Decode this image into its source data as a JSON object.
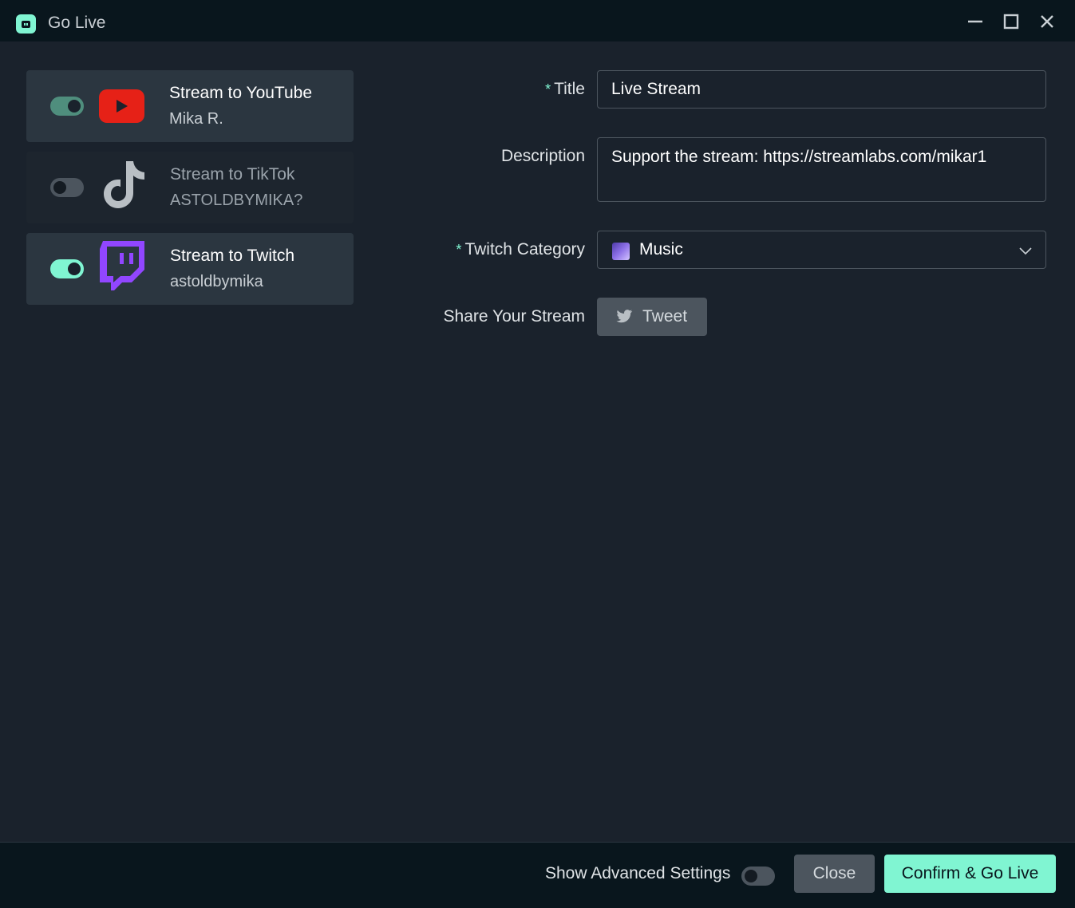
{
  "window": {
    "title": "Go Live",
    "app_icon": "streamlabs-icon",
    "controls": [
      "minimize-icon",
      "maximize-icon",
      "close-icon"
    ]
  },
  "platforms": [
    {
      "name": "Stream to YouTube",
      "user": "Mika R.",
      "enabled": true,
      "icon": "youtube-icon"
    },
    {
      "name": "Stream to TikTok",
      "user": "ASTOLDBYMIKA?",
      "enabled": false,
      "icon": "tiktok-icon"
    },
    {
      "name": "Stream to Twitch",
      "user": "astoldbymika",
      "enabled": true,
      "icon": "twitch-icon"
    }
  ],
  "form": {
    "required_marker": "*",
    "title_label": "Title",
    "title_value": "Live Stream",
    "description_label": "Description",
    "description_value": "Support the stream: https://streamlabs.com/mikar1",
    "category_label": "Twitch Category",
    "category_value": "Music",
    "share_label": "Share Your Stream",
    "tweet_label": "Tweet"
  },
  "footer": {
    "advanced_label": "Show Advanced Settings",
    "advanced_enabled": false,
    "close_label": "Close",
    "go_live_label": "Confirm & Go Live"
  },
  "colors": {
    "accent": "#80f5d2",
    "background": "#1a222c",
    "titlebar": "#09161d",
    "youtube": "#e62117",
    "twitch": "#9146ff"
  }
}
